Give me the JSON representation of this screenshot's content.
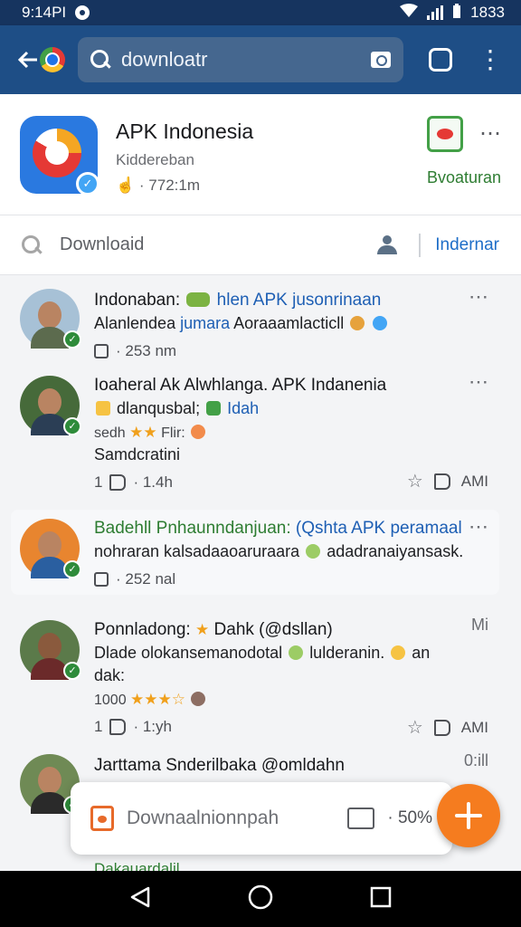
{
  "status": {
    "time": "9:14PI",
    "battery": "1833"
  },
  "toolbar": {
    "search_text": "downloatr"
  },
  "app": {
    "title": "APK Indonesia",
    "subtitle": "Kiddereban",
    "stat": "· 772:1m",
    "action": "Bvoaturan"
  },
  "download_bar": {
    "label": "Downloaid",
    "link": "Indernar"
  },
  "posts": [
    {
      "name": "Indonaban:",
      "name_extra": "hlen APK jusonrinaan",
      "line1a": "Alanlendea",
      "line1b": "jumara",
      "line1c": "Aoraaamlacticll",
      "meta": "· 253 nm"
    },
    {
      "name": "Ioaheral Ak Alwhlanga. APK Indanenia",
      "line1a": "dlanqusbal;",
      "line1b": "Idah",
      "rating_prefix": "sedh",
      "rating_suffix": "Flir:",
      "line3": "Samdcratini",
      "likes": "1",
      "views": "· 1.4h",
      "action": "AMI"
    },
    {
      "name": "Badehll Pnhaunndanjuan:",
      "name_extra": "(Qshta APK peramaal",
      "line1": "nohraran kalsadaaoaruraara",
      "line1b": "adadranaiyansask.",
      "meta": "· 252 nal"
    },
    {
      "name": "Ponnladong:",
      "name_extra": "Dahk (@dsllan)",
      "time": "Mi",
      "line1": "Dlade olokansemanodotal",
      "line1b": "lulderanin.",
      "line1c": "an",
      "line2": "dak:",
      "rating_prefix": "1000",
      "likes": "1",
      "views": "· 1:yh",
      "action": "AMI"
    },
    {
      "name": "Jarttama Snderilbaka @omldahn",
      "time": "0:ill"
    }
  ],
  "bottom": {
    "label": "Downaalnionnpah",
    "pct": "· 50%"
  },
  "peek": "Dakauardalil",
  "colors": {
    "toolbar": "#1e4e86",
    "statusbar": "#16345f",
    "accent_green": "#2e7d32",
    "link_blue": "#1e6ec8",
    "fab": "#f57c1f"
  }
}
